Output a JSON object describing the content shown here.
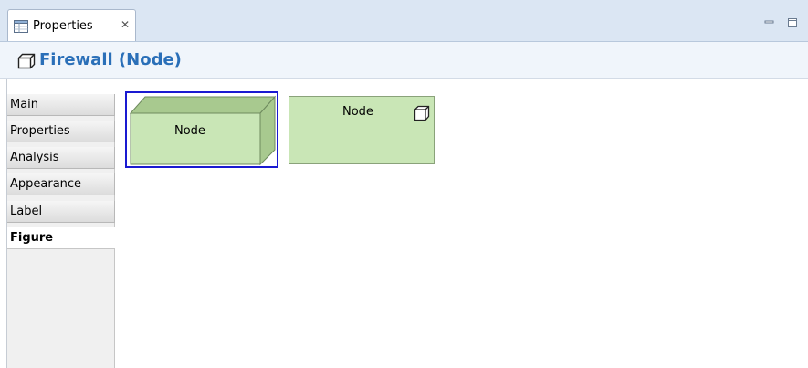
{
  "tab": {
    "label": "Properties",
    "close": "✕"
  },
  "title": {
    "text": "Firewall (Node)"
  },
  "sidebar": {
    "items": [
      {
        "label": "Main"
      },
      {
        "label": "Properties"
      },
      {
        "label": "Analysis"
      },
      {
        "label": "Appearance"
      },
      {
        "label": "Label"
      },
      {
        "label": "Figure"
      }
    ],
    "selected": "Figure"
  },
  "figures": [
    {
      "label": "Node",
      "style": "3d-box",
      "selected": true
    },
    {
      "label": "Node",
      "style": "rectangle-with-icon",
      "selected": false
    }
  ],
  "colors": {
    "node_fill": "#c9e6b6",
    "node_shade": "#a8c98f",
    "selection_border": "#1a1ad1",
    "title_text": "#2a6fb8"
  }
}
